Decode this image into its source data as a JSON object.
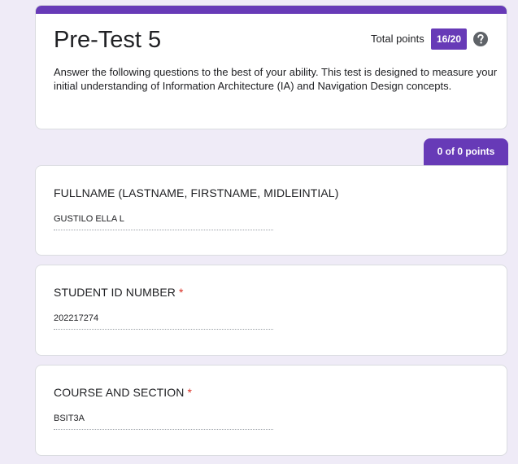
{
  "form": {
    "title": "Pre-Test 5",
    "total_points_label": "Total points",
    "score": "16/20",
    "help_icon": "help-circle-icon",
    "description": " Answer the following questions to the best of your ability. This test is designed to measure your initial understanding of Information Architecture (IA) and Navigation Design concepts."
  },
  "section": {
    "points": "0 of 0 points"
  },
  "questions": [
    {
      "title": "FULLNAME (LASTNAME, FIRSTNAME, MIDLEINTIAL)",
      "required": "",
      "answer": "GUSTILO ELLA L"
    },
    {
      "title": "STUDENT ID NUMBER",
      "required": "*",
      "answer": "202217274"
    },
    {
      "title": "COURSE AND SECTION",
      "required": "*",
      "answer": "BSIT3A"
    }
  ],
  "colors": {
    "accent": "#673ab7",
    "background": "#efebf7",
    "required": "#d93025"
  }
}
